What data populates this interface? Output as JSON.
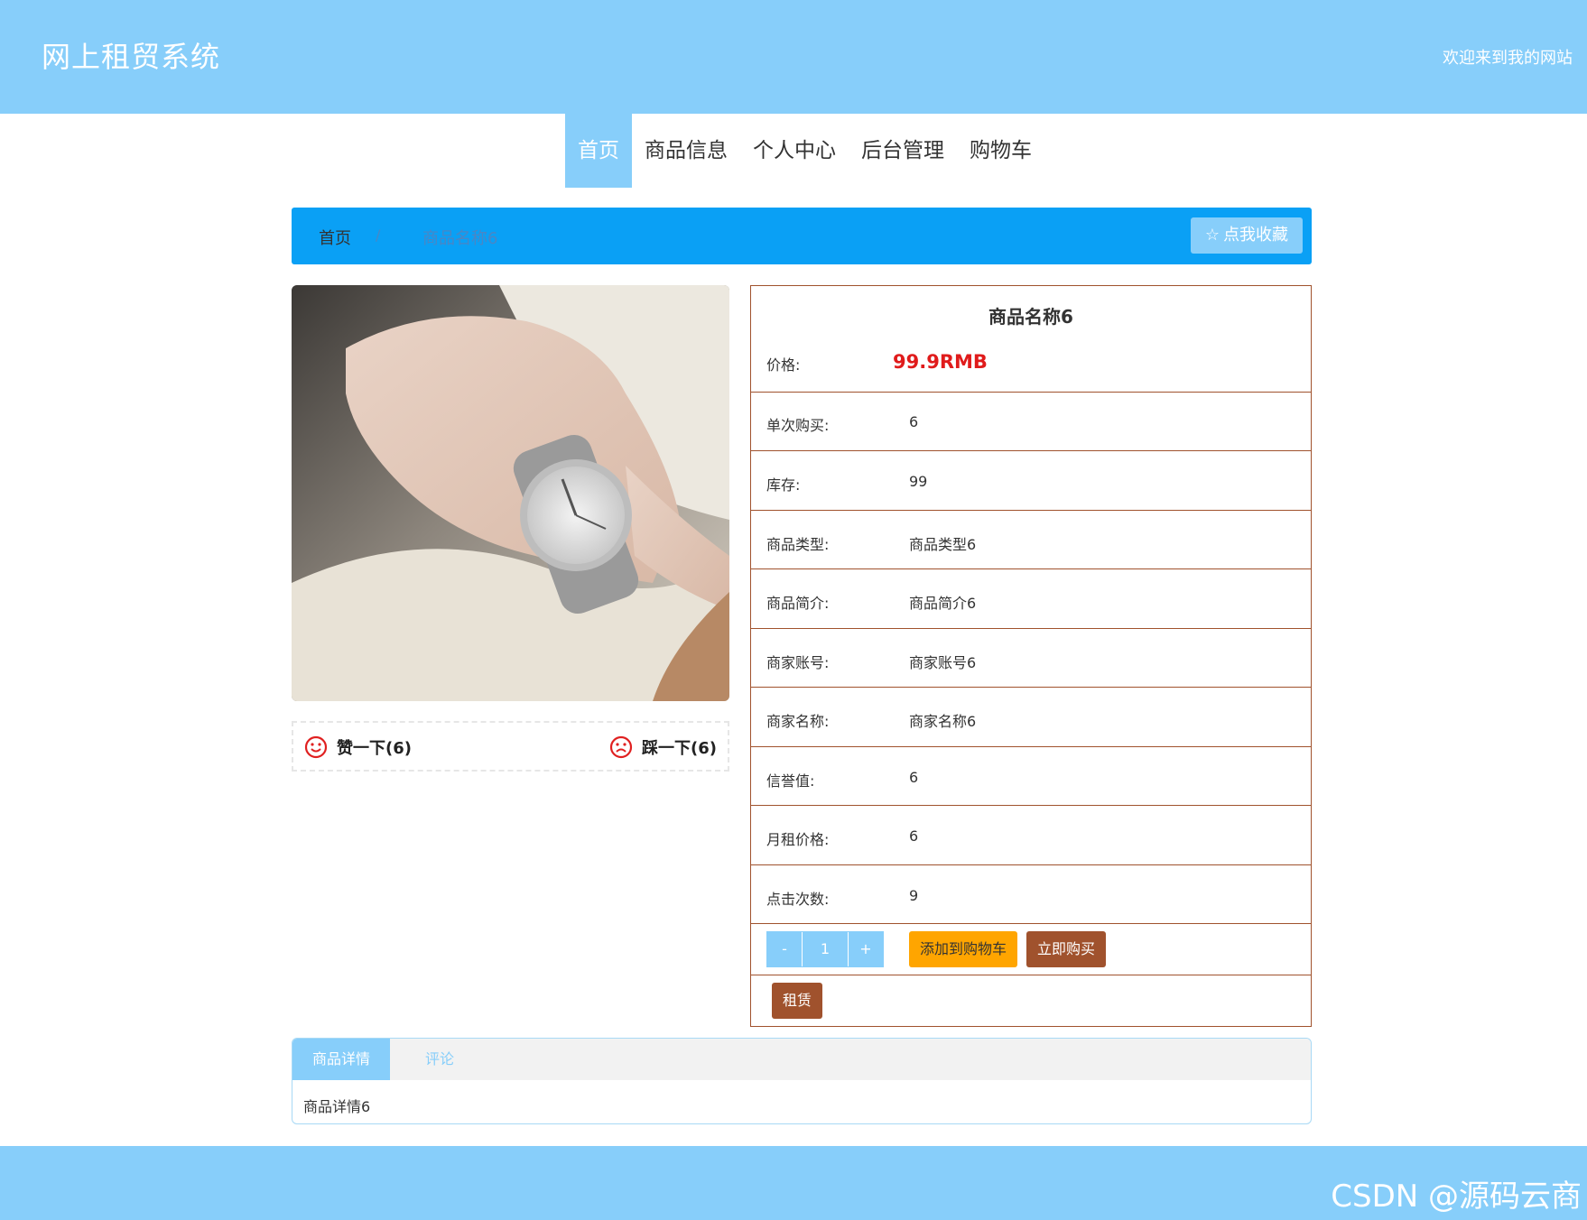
{
  "header": {
    "site_title": "网上租贸系统",
    "welcome": "欢迎来到我的网站"
  },
  "nav": {
    "items": [
      "首页",
      "商品信息",
      "个人中心",
      "后台管理",
      "购物车"
    ],
    "active_index": 0
  },
  "breadcrumb": {
    "home": "首页",
    "separator": "/",
    "current": "商品名称6",
    "favorite_button": "点我收藏",
    "favorite_icon": "star-icon"
  },
  "votes": {
    "like_label": "赞一下(6)",
    "dislike_label": "踩一下(6)",
    "like_icon": "smile-icon",
    "dislike_icon": "frown-icon"
  },
  "product": {
    "title": "商品名称6",
    "price_label": "价格:",
    "price_value": "99.9RMB",
    "fields": [
      {
        "label": "单次购买:",
        "value": "6"
      },
      {
        "label": "库存:",
        "value": "99"
      },
      {
        "label": "商品类型:",
        "value": "商品类型6"
      },
      {
        "label": "商品简介:",
        "value": "商品简介6"
      },
      {
        "label": "商家账号:",
        "value": "商家账号6"
      },
      {
        "label": "商家名称:",
        "value": "商家名称6"
      },
      {
        "label": "信誉值:",
        "value": "6"
      },
      {
        "label": "月租价格:",
        "value": "6"
      },
      {
        "label": "点击次数:",
        "value": "9"
      }
    ],
    "quantity": {
      "minus": "-",
      "value": "1",
      "plus": "+"
    },
    "add_to_cart": "添加到购物车",
    "buy_now": "立即购买",
    "rent": "租赁"
  },
  "tabs": {
    "items": [
      "商品详情",
      "评论"
    ],
    "active_index": 0,
    "content": "商品详情6"
  },
  "watermark": "CSDN @源码云商",
  "colors": {
    "header_bg": "#87cefa",
    "crumb_bg": "#0aa0f5",
    "price": "#e01b1b",
    "border": "#a0522d",
    "cart_btn": "#ffa500",
    "buy_btn": "#a0522d"
  }
}
